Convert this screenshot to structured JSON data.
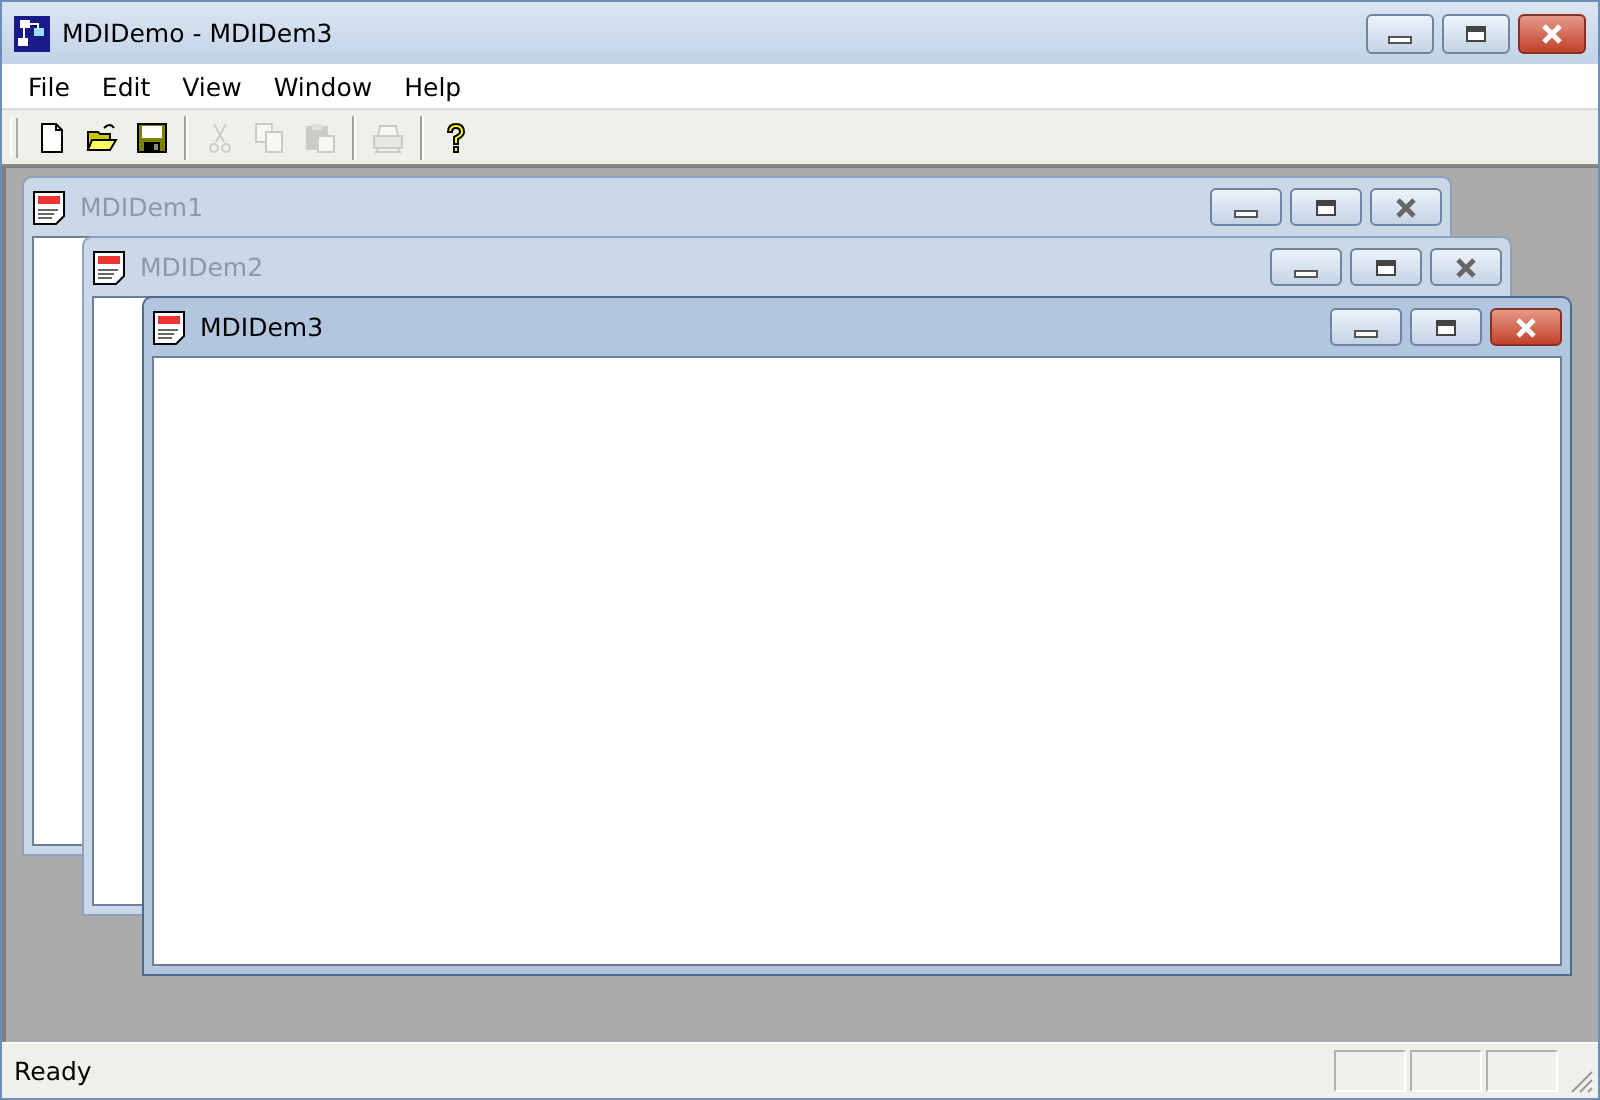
{
  "window": {
    "title": "MDIDemo - MDIDem3"
  },
  "menu": [
    {
      "label": "File"
    },
    {
      "label": "Edit"
    },
    {
      "label": "View"
    },
    {
      "label": "Window"
    },
    {
      "label": "Help"
    }
  ],
  "toolbar": [
    {
      "kind": "new",
      "disabled": false
    },
    {
      "kind": "open",
      "disabled": false
    },
    {
      "kind": "save",
      "disabled": false
    },
    {
      "kind": "separator"
    },
    {
      "kind": "cut",
      "disabled": true
    },
    {
      "kind": "copy",
      "disabled": true
    },
    {
      "kind": "paste",
      "disabled": true
    },
    {
      "kind": "separator"
    },
    {
      "kind": "print",
      "disabled": true
    },
    {
      "kind": "separator"
    },
    {
      "kind": "help",
      "disabled": false
    }
  ],
  "child_windows": [
    {
      "title": "MDIDem1",
      "active": false
    },
    {
      "title": "MDIDem2",
      "active": false
    },
    {
      "title": "MDIDem3",
      "active": true
    }
  ],
  "status_bar": {
    "text": "Ready"
  }
}
